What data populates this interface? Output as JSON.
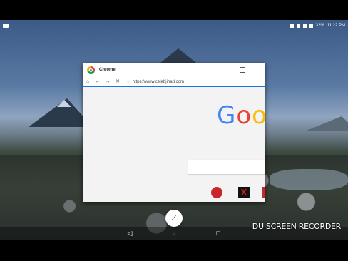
{
  "status_bar": {
    "battery": "32%",
    "time": "11:22 PM"
  },
  "window": {
    "title": "Chrome",
    "url": "https://www.celebjihad.com",
    "toolbar": {
      "home_icon": "home-icon",
      "back_icon": "back-arrow-icon",
      "forward_icon": "forward-arrow-icon",
      "close_icon": "close-icon",
      "lock_icon": "lock-icon"
    },
    "page": {
      "logo_text_1": "G",
      "logo_text_2": "o",
      "logo_text_3": "o",
      "shortcut_2": "X"
    }
  },
  "watermark": "DU SCREEN RECORDER"
}
